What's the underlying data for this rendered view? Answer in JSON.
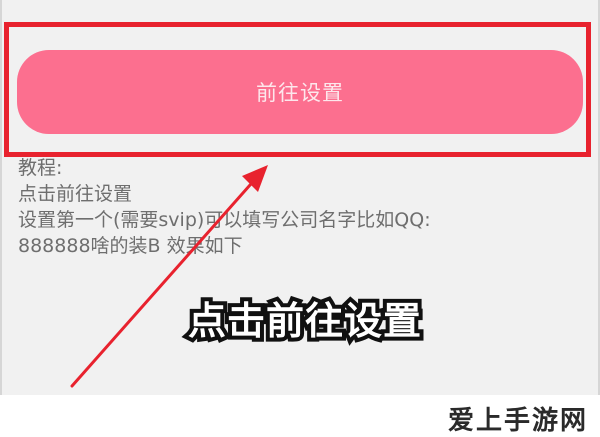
{
  "settings_page": {
    "goto_button_label": "前往设置",
    "tutorial_lines": [
      "教程:",
      "点击前往设置",
      "设置第一个(需要svip)可以填写公司名字比如QQ:",
      "888888啥的装B  效果如下"
    ]
  },
  "annotation": {
    "caption": "点击前往设置",
    "highlight_color": "#e8222e",
    "arrow_color": "#e8222e"
  },
  "colors": {
    "button": "#fc6f8f",
    "button_text": "#fde7ec",
    "screen_bg": "#f1f1f1",
    "tutorial_text": "#6e6e6e"
  },
  "watermark": "爱上手游网"
}
